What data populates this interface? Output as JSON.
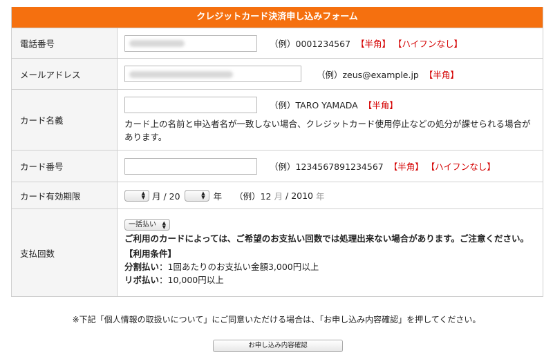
{
  "header": {
    "title": "クレジットカード決済申し込みフォーム"
  },
  "rows": {
    "phone": {
      "label": "電話番号",
      "example": "（例）0001234567",
      "tags": [
        "【半角】",
        "【ハイフンなし】"
      ]
    },
    "email": {
      "label": "メールアドレス",
      "example": "（例）zeus@example.jp",
      "tags": [
        "【半角】"
      ]
    },
    "name": {
      "label": "カード名義",
      "example": "（例）TARO YAMADA",
      "tags": [
        "【半角】"
      ],
      "note": "カード上の名前と申込者名が一致しない場合、クレジットカード使用停止などの処分が課せられる場合があります。"
    },
    "number": {
      "label": "カード番号",
      "example": "（例）1234567891234567",
      "tags": [
        "【半角】",
        "【ハイフンなし】"
      ]
    },
    "expiry": {
      "label": "カード有効期限",
      "month_unit": "月 / 20",
      "year_unit": "年",
      "example_prefix": "（例）12",
      "example_month_unit": "月",
      "example_sep": "/ 2010",
      "example_year_unit": "年"
    },
    "payment": {
      "label": "支払回数",
      "select_value": "一括払い",
      "warning": "ご利用のカードによっては、ご希望のお支払い回数では処理出来ない場合があります。ご注意ください。",
      "conditions_title": "【利用条件】",
      "installment_label": "分割払い",
      "installment_text": "：1回あたりのお支払い金額3,000円以上",
      "revolving_label": "リボ払い",
      "revolving_text": "：10,000円以上"
    }
  },
  "footer": {
    "note": "※下記「個人情報の取扱いについて」にご同意いただける場合は、「お申し込み内容確認」を押してください。",
    "submit_label": "お申し込み内容確認"
  },
  "colors": {
    "header": "#f5700f",
    "required": "#d40000"
  }
}
